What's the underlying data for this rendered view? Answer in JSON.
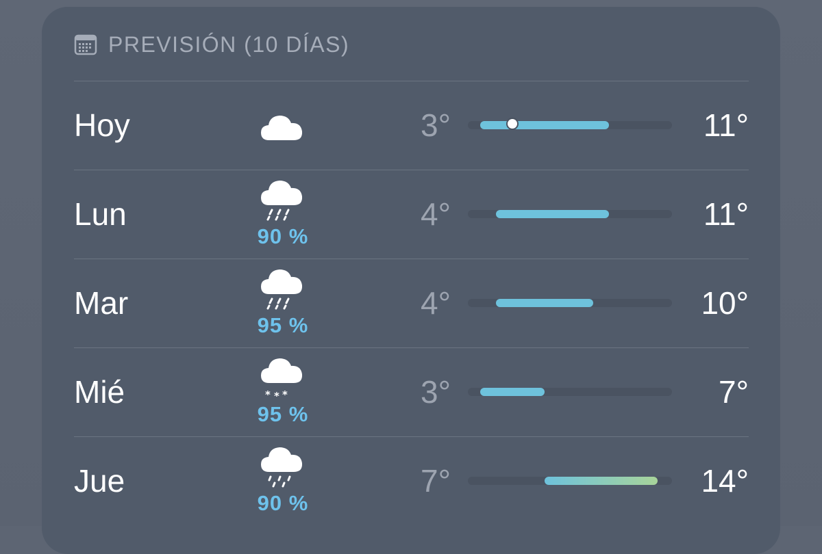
{
  "header": {
    "icon": "calendar-icon",
    "label": "PREVISIÓN (10 DÍAS)"
  },
  "colors": {
    "card": "#515b6a",
    "cool_bar": "#6ec2dc",
    "warm_bar_end": "#a8d49a",
    "precip_text": "#6ec2ec",
    "track": "#4a5361"
  },
  "scale": {
    "min": 3,
    "max": 14
  },
  "days": [
    {
      "day": "Hoy",
      "icon": "cloud-icon",
      "precip": "",
      "low": "3°",
      "high": "11°",
      "low_val": 3,
      "high_val": 11,
      "current_val": 5
    },
    {
      "day": "Lun",
      "icon": "rain-icon",
      "precip": "90 %",
      "low": "4°",
      "high": "11°",
      "low_val": 4,
      "high_val": 11
    },
    {
      "day": "Mar",
      "icon": "rain-icon",
      "precip": "95 %",
      "low": "4°",
      "high": "10°",
      "low_val": 4,
      "high_val": 10
    },
    {
      "day": "Mié",
      "icon": "snow-icon",
      "precip": "95 %",
      "low": "3°",
      "high": "7°",
      "low_val": 3,
      "high_val": 7
    },
    {
      "day": "Jue",
      "icon": "drizzle-icon",
      "precip": "90 %",
      "low": "7°",
      "high": "14°",
      "low_val": 7,
      "high_val": 14
    }
  ]
}
